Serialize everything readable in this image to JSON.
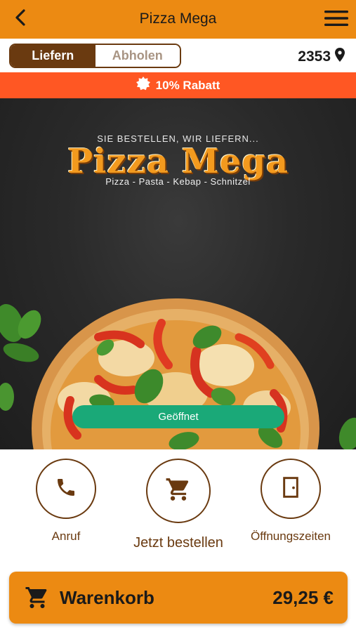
{
  "header": {
    "title": "Pizza Mega"
  },
  "mode": {
    "deliver_label": "Liefern",
    "pickup_label": "Abholen",
    "selected": "Liefern",
    "postal_code": "2353"
  },
  "banner": {
    "text": "10% Rabatt"
  },
  "hero": {
    "tagline": "SIE BESTELLEN, WIR LIEFERN...",
    "logo": "Pizza Mega",
    "subtitle": "Pizza - Pasta - Kebap - Schnitzel",
    "status": "Geöffnet"
  },
  "actions": [
    {
      "label": "Anruf",
      "icon": "phone-icon"
    },
    {
      "label": "Jetzt bestellen",
      "icon": "cart-icon"
    },
    {
      "label": "Öffnungszeiten",
      "icon": "door-icon"
    }
  ],
  "cart": {
    "label": "Warenkorb",
    "total": "29,25 €"
  },
  "colors": {
    "header": "#ec8a12",
    "brown": "#6a3a10",
    "banner": "#ff5723",
    "open_status": "#1aa978"
  }
}
